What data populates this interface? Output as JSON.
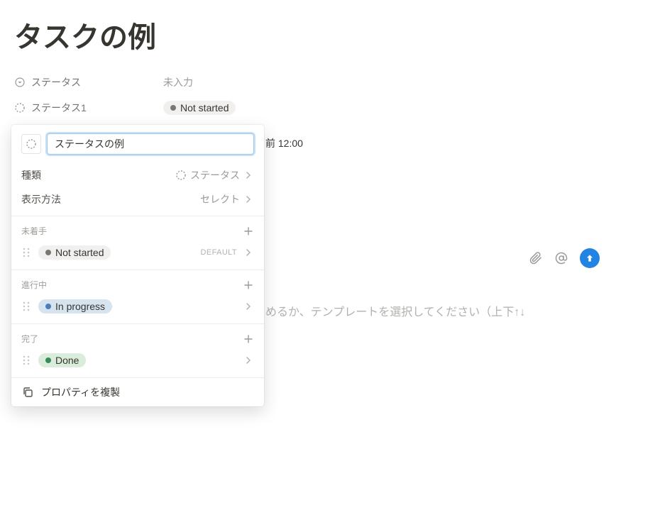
{
  "page": {
    "title": "タスクの例"
  },
  "properties": {
    "status": {
      "label": "ステータス",
      "value": "未入力"
    },
    "status1": {
      "label": "ステータス1",
      "value": "Not started"
    },
    "datePartial": "前 12:00"
  },
  "hint": "めるか、テンプレートを選択してください（上下↑↓",
  "popup": {
    "input": "ステータスの例",
    "config": {
      "typeLabel": "種類",
      "typeValue": "ステータス",
      "displayLabel": "表示方法",
      "displayValue": "セレクト"
    },
    "groups": {
      "todo": {
        "label": "未着手",
        "items": [
          {
            "label": "Not started",
            "default": "DEFAULT"
          }
        ]
      },
      "inprogress": {
        "label": "進行中",
        "items": [
          {
            "label": "In progress"
          }
        ]
      },
      "done": {
        "label": "完了",
        "items": [
          {
            "label": "Done"
          }
        ]
      }
    },
    "actions": {
      "duplicate": "プロパティを複製"
    }
  }
}
